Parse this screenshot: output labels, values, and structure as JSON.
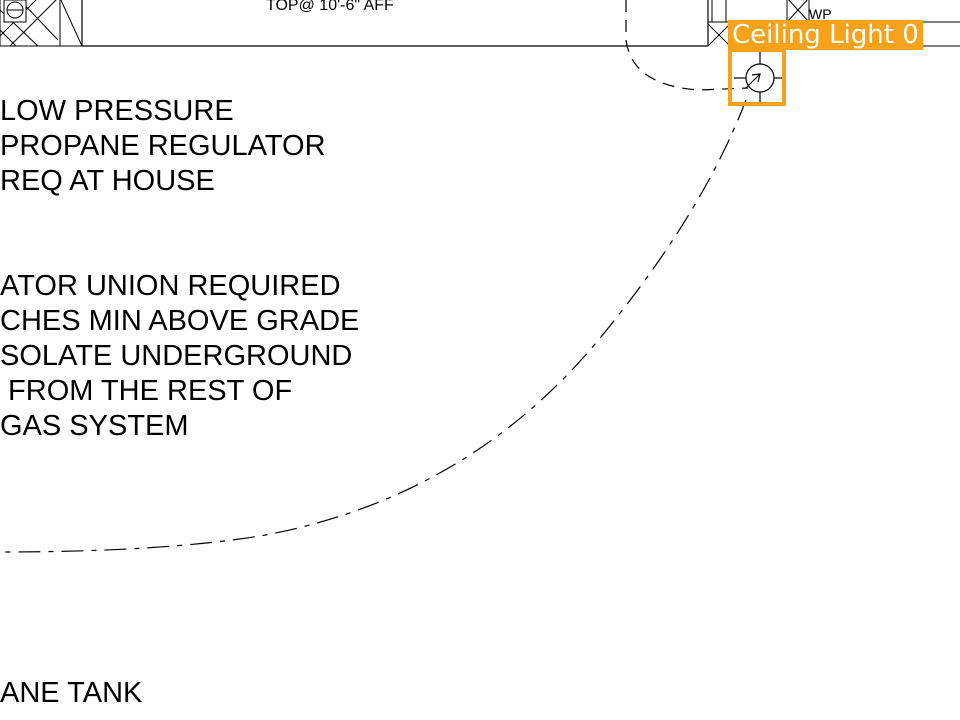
{
  "wall": {
    "top_note": "TOP@ 10'-6\" AFF"
  },
  "notes": {
    "regulator": [
      "LOW PRESSURE",
      "PROPANE REGULATOR",
      "REQ AT HOUSE"
    ],
    "union": [
      "ATOR UNION REQUIRED",
      "CHES MIN ABOVE GRADE",
      "SOLATE UNDERGROUND",
      " FROM THE REST OF",
      "GAS SYSTEM"
    ],
    "tank": [
      "ANE TANK"
    ]
  },
  "device": {
    "wp_label": "WP"
  },
  "annotation": {
    "label": "Ceiling Light 0",
    "color": "#f7a21b"
  },
  "icons": [
    "receptacle-icon",
    "ceiling-light-icon"
  ]
}
